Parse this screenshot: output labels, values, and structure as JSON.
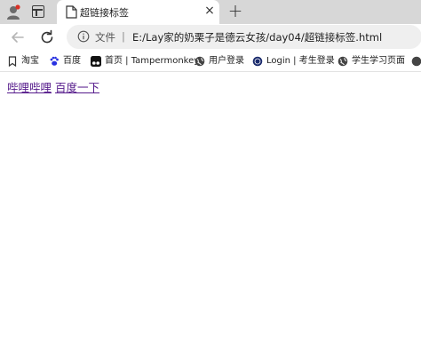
{
  "tab": {
    "title": "超链接标签",
    "close_glyph": "×"
  },
  "newtab_glyph": "+",
  "omnibox": {
    "file_label": "文件",
    "separator": "|",
    "url": "E:/Lay家的奶栗子是德云女孩/day04/超链接标签.html"
  },
  "bookmarks": [
    {
      "label": "淘宝",
      "icon": "bookmark-icon"
    },
    {
      "label": "百度",
      "icon": "baidu-paw-icon"
    },
    {
      "label": "首页 | Tampermonkey",
      "icon": "tampermonkey-icon"
    },
    {
      "label": "用户登录",
      "icon": "globe-icon"
    },
    {
      "label": "Login | 考生登录",
      "icon": "globe-icon"
    },
    {
      "label": "学生学习页面",
      "icon": "globe-icon"
    }
  ],
  "links": [
    {
      "text": "哔哩哔哩"
    },
    {
      "text": "百度一下"
    }
  ],
  "colors": {
    "visited_link": "#551a8b",
    "tabstrip": "#d7d7d7",
    "omnibox": "#efefef"
  }
}
